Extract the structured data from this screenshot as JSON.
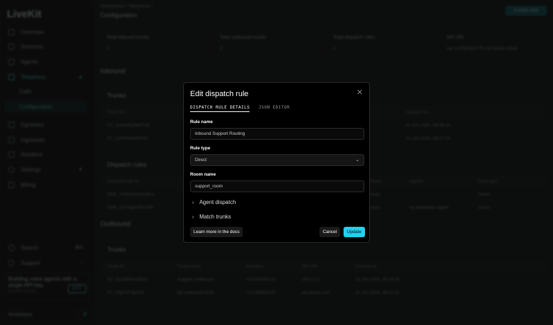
{
  "sidebar": {
    "logo": "LiveKit",
    "items": [
      {
        "label": "Overview"
      },
      {
        "label": "Sessions"
      },
      {
        "label": "Agents"
      },
      {
        "label": "Telephony"
      },
      {
        "label": "Calls"
      },
      {
        "label": "Configuration"
      },
      {
        "label": "Egresses"
      },
      {
        "label": "Ingresses"
      },
      {
        "label": "Sandbox"
      },
      {
        "label": "Settings"
      },
      {
        "label": "Billing"
      }
    ],
    "search": "Search",
    "search_shortcut": "⌘K",
    "support": "Support",
    "promo": {
      "text": "Building voice agents with a single API key.",
      "sub": "LEARN MORE",
      "badge": "STT"
    },
    "project": "Nicelydone",
    "project_initial": "P"
  },
  "header": {
    "breadcrumb": [
      "Nicelydone",
      "Telephony"
    ],
    "title": "Configuration",
    "create_button": "Create new"
  },
  "stats": [
    {
      "label": "Total inbound trunks",
      "value": "2"
    },
    {
      "label": "Total outbound trunks",
      "value": "2"
    },
    {
      "label": "Total dispatch rules",
      "value": "2"
    },
    {
      "label": "SIP URI",
      "value": "sip:1ocl963pr179.sip.livekit.cloud"
    }
  ],
  "inbound": {
    "title": "Inbound",
    "trunks": {
      "title": "Trunks",
      "columns": [
        "Trunk ID",
        "Created at ↑"
      ],
      "rows": [
        [
          "ST_2uvPeKQNWT4C",
          "31 Oct 2025, 08:58:20"
        ],
        [
          "ST_vvKR3vkENFXV",
          "31 Oct 2025, 08:17:15"
        ]
      ]
    },
    "dispatch": {
      "title": "Dispatch rules",
      "columns": [
        "Dispatch rule ID",
        "Room",
        "Agents",
        "Rule type"
      ],
      "rows": [
        [
          "SDR_27hGUNomGdLa",
          "room",
          "–",
          "Direct"
        ],
        [
          "SDR_DCY5gwSP37BP",
          "room",
          "my telephone agent",
          "Direct"
        ]
      ]
    }
  },
  "outbound": {
    "title": "Outbound",
    "trunks": {
      "title": "Trunks",
      "columns": [
        "Trunk ID",
        "Trunk name",
        "Numbers",
        "SIP URI",
        "Created at ↓"
      ],
      "rows": [
        [
          "ST_Qr1B6WvG8thA",
          "Support Outbound",
          "+14155550121",
          "192.0.2.0",
          "31 Oct 2025, 09:18:16"
        ],
        [
          "ST_P9yTvF3jsxh3",
          "My outbound trunk",
          "+12135550100",
          "sip.telnyx.com",
          "31 Oct 2025, 08:07:41"
        ]
      ]
    }
  },
  "modal": {
    "title": "Edit dispatch rule",
    "tabs": [
      "DISPATCH RULE DETAILS",
      "JSON EDITOR"
    ],
    "rule_name_label": "Rule name",
    "rule_name": "Inbound Support Routing",
    "rule_type_label": "Rule type",
    "rule_type": "Direct",
    "room_name_label": "Room name",
    "room_name": "support_room",
    "agent_dispatch": "Agent dispatch",
    "match_trunks": "Match trunks",
    "docs_button": "Learn more in the docs",
    "cancel_button": "Cancel",
    "update_button": "Update"
  },
  "colors": {
    "accent": "#21d1f0",
    "active_nav": "#112426"
  }
}
